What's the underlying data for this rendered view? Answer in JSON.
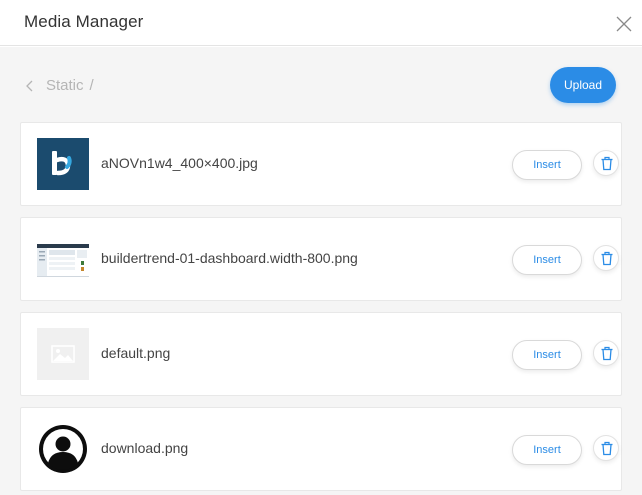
{
  "header": {
    "title": "Media Manager"
  },
  "toolbar": {
    "breadcrumb_folder": "Static",
    "breadcrumb_separator": "/",
    "upload_label": "Upload"
  },
  "files": [
    {
      "name": "aNOVn1w4_400×400.jpg",
      "insert_label": "Insert",
      "thumbnail": "brand-logo-b"
    },
    {
      "name": "buildertrend-01-dashboard.width-800.png",
      "insert_label": "Insert",
      "thumbnail": "dashboard-screenshot"
    },
    {
      "name": "default.png",
      "insert_label": "Insert",
      "thumbnail": "image-placeholder-icon"
    },
    {
      "name": "download.png",
      "insert_label": "Insert",
      "thumbnail": "user-avatar-icon"
    }
  ],
  "colors": {
    "accent": "#2b8ce6",
    "logo_bg": "#1b4b6e",
    "logo_accent": "#35a8e0"
  }
}
